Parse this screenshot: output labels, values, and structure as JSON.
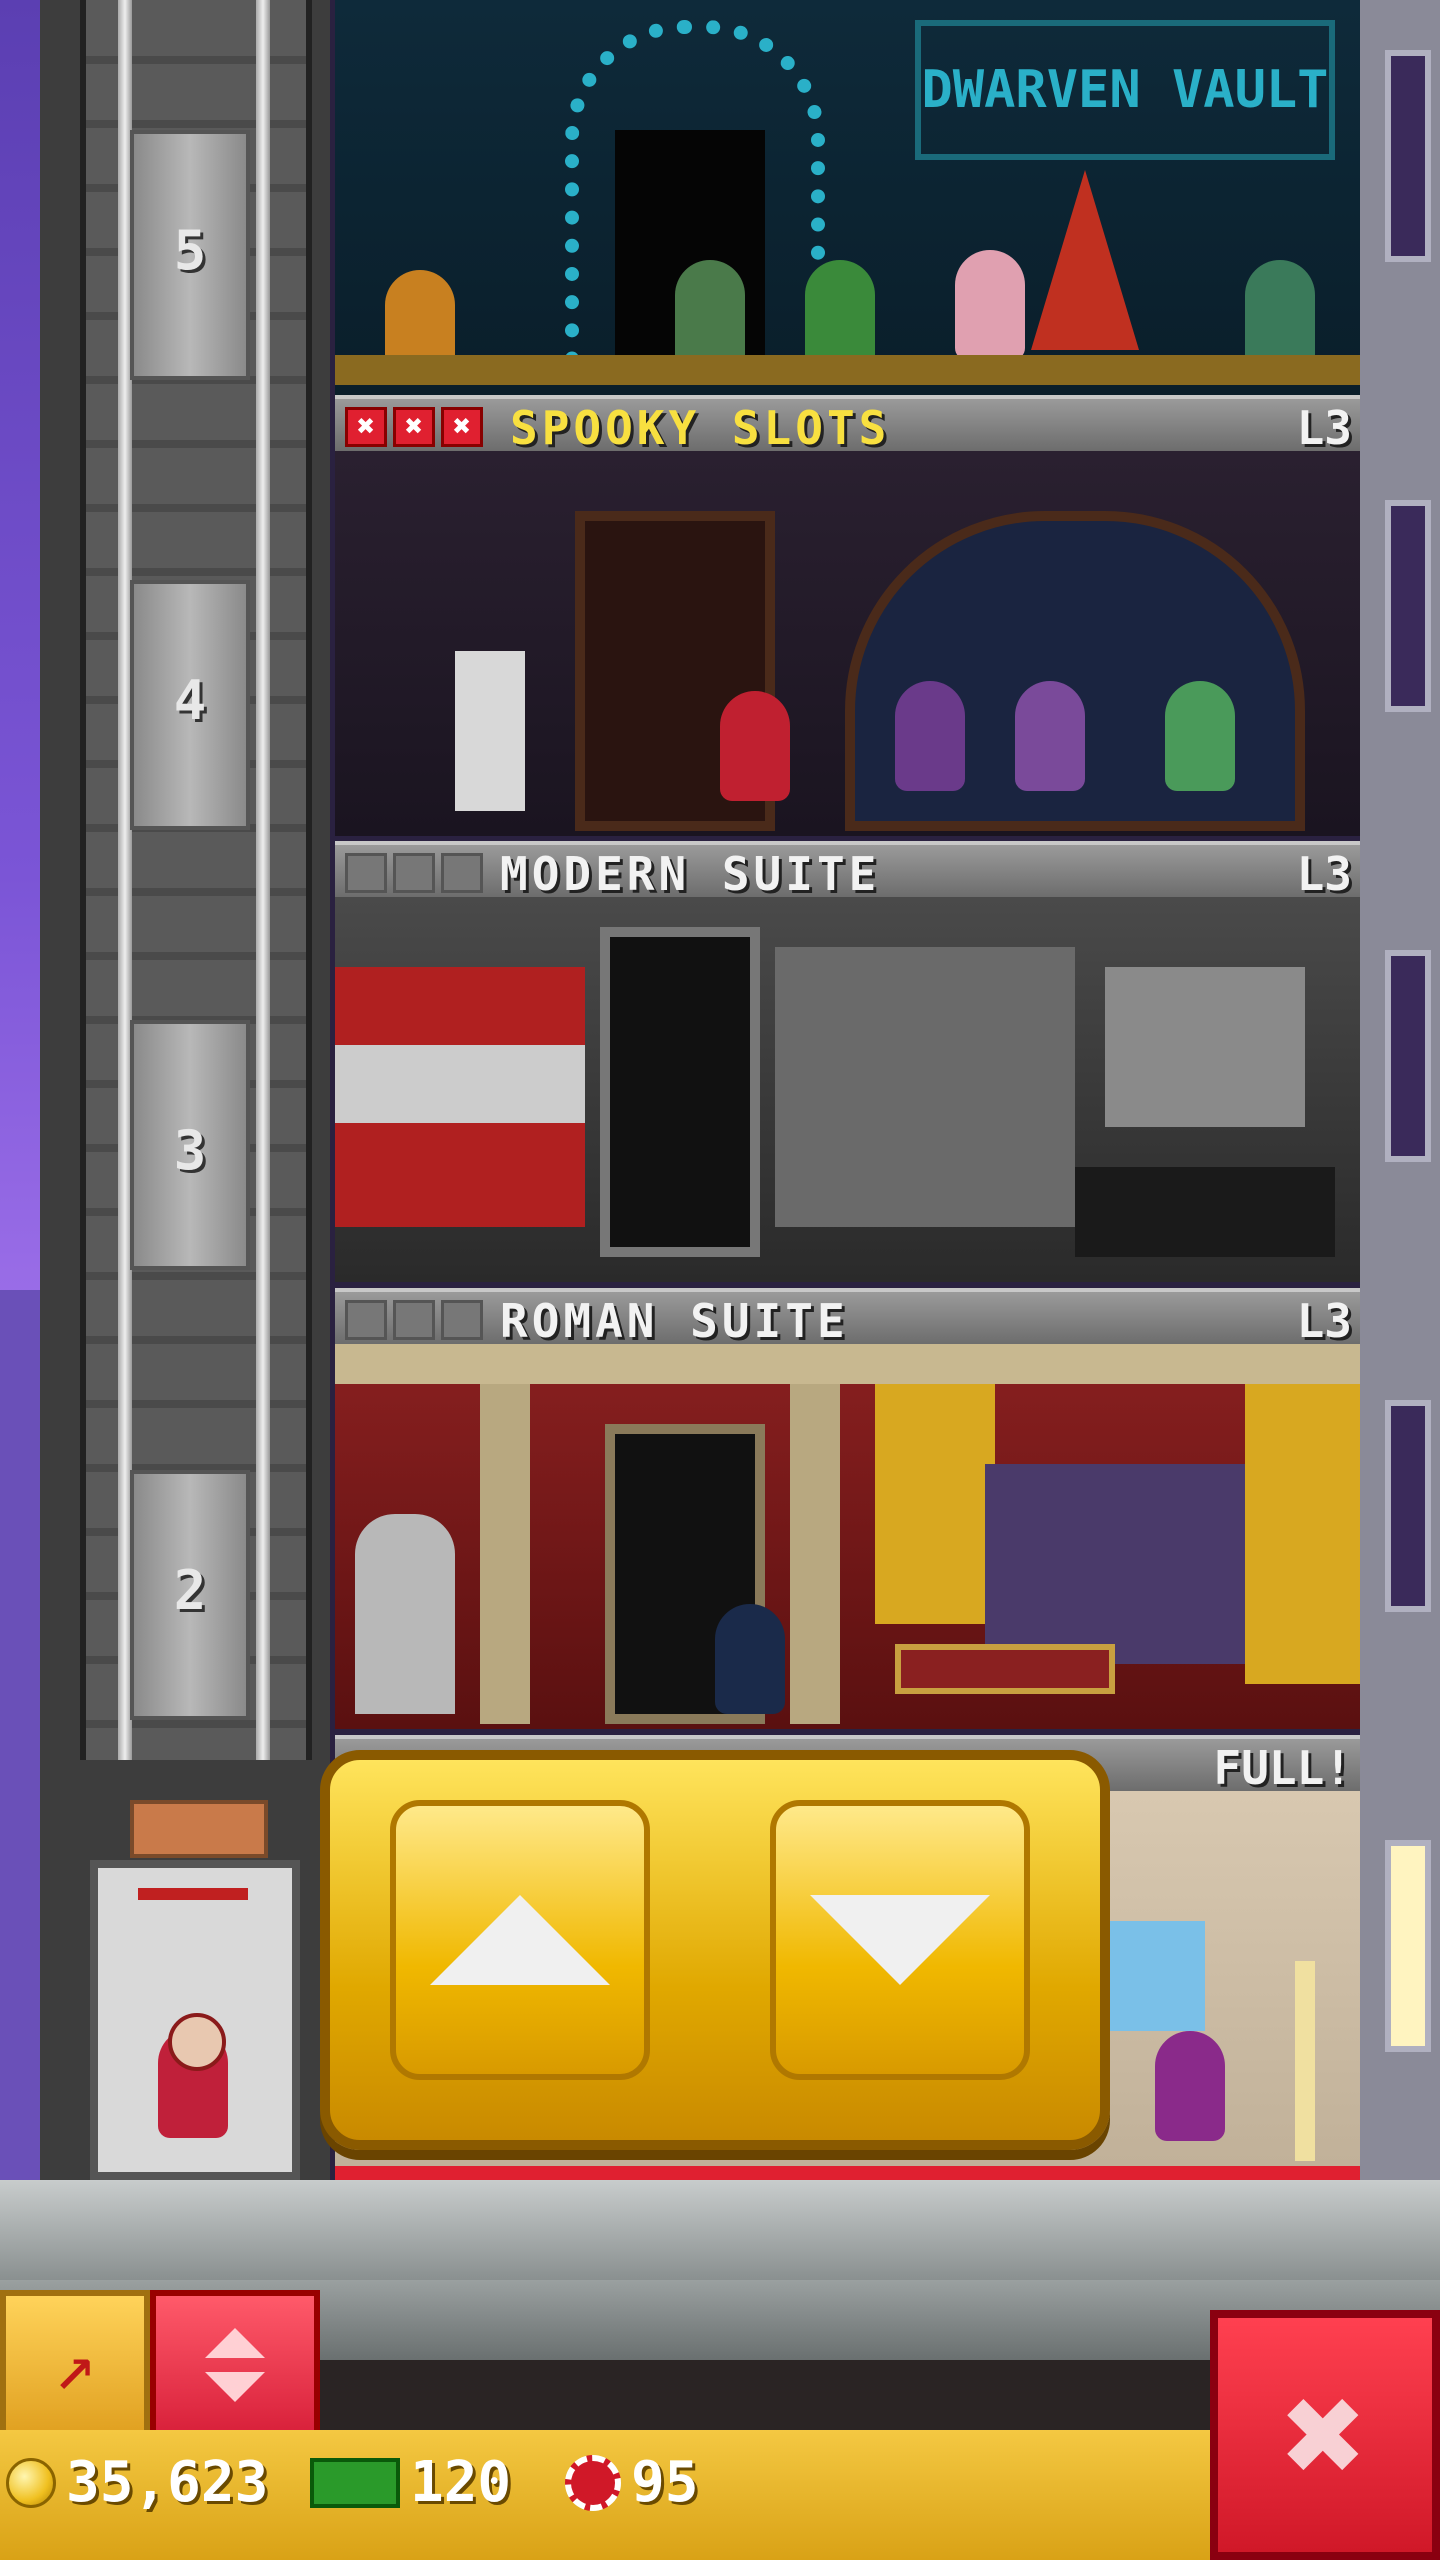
{
  "elevator": {
    "floor_numbers": [
      "5",
      "4",
      "3",
      "2"
    ]
  },
  "floors": [
    {
      "id": "dwarven-vault",
      "sign_text": "DWARVEN VAULT",
      "name": "",
      "level": ""
    },
    {
      "id": "spooky-slots",
      "name": "SPOOKY SLOTS",
      "level": "L3",
      "stars_active": 3,
      "star_symbol": "✖"
    },
    {
      "id": "modern-suite",
      "name": "MODERN SUITE",
      "level": "L3",
      "stars_active": 0
    },
    {
      "id": "roman-suite",
      "name": "ROMAN SUITE",
      "level": "L3",
      "stars_active": 0
    },
    {
      "id": "lobby-floor",
      "status": "FULL!"
    }
  ],
  "controls": {
    "up_icon": "arrow-up-icon",
    "down_icon": "arrow-down-icon",
    "tool_icon": "arrow-tool-icon",
    "elevator_toggle_icon": "elevator-updown-icon",
    "close_symbol": "✖"
  },
  "currency": {
    "coins": "35,623",
    "bux": "120",
    "chips": "95"
  },
  "colors": {
    "gold": "#f0b800",
    "red": "#d01828",
    "sky": "#7b55d6"
  }
}
